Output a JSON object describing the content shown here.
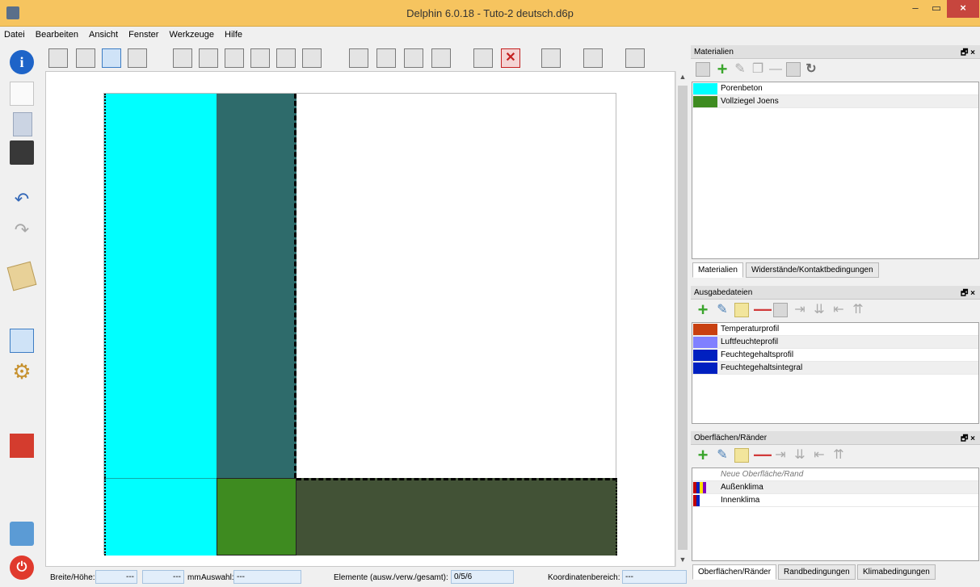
{
  "window": {
    "title": "Delphin 6.0.18 - Tuto-2 deutsch.d6p",
    "close_label": "×",
    "min_label": "–",
    "max_label": "▭"
  },
  "menu": [
    "Datei",
    "Bearbeiten",
    "Ansicht",
    "Fenster",
    "Werkzeuge",
    "Hilfe"
  ],
  "sidebar_icons": [
    "info-icon",
    "new-document-icon",
    "open-icon",
    "save-icon",
    "undo-icon",
    "redo-icon",
    "notes-icon",
    "geometry-icon",
    "settings-gears-icon",
    "flag-icon",
    "chat-icon",
    "power-icon"
  ],
  "canvas": {
    "cells": [
      {
        "name": "cyan-top",
        "color": "#00ffff"
      },
      {
        "name": "teal",
        "color": "#2e6b6b"
      },
      {
        "name": "cyan-bottom",
        "color": "#00ffff"
      },
      {
        "name": "green",
        "color": "#3e8b20"
      },
      {
        "name": "dark-green",
        "color": "#425236"
      }
    ]
  },
  "statusbar": {
    "breite_label": "Breite/Höhe:",
    "breite_value": "---",
    "hoehe_value": "---",
    "unit": "mm",
    "auswahl_label": "Auswahl:",
    "auswahl_value": "---",
    "elemente_label": "Elemente (ausw./verw./gesamt):",
    "elemente_value": "0/5/6",
    "koord_label": "Koordinatenbereich:",
    "koord_value": "---"
  },
  "materials": {
    "title": "Materialien",
    "items": [
      {
        "name": "Porenbeton",
        "color": "#00ffff"
      },
      {
        "name": "Vollziegel Joens",
        "color": "#3e8b20"
      }
    ],
    "tabs": [
      "Materialien",
      "Widerstände/Kontaktbedingungen"
    ]
  },
  "outputs": {
    "title": "Ausgabedateien",
    "items": [
      {
        "name": "Temperaturprofil",
        "color": "#c84010"
      },
      {
        "name": "Luftfeuchteprofil",
        "color": "#8080ff"
      },
      {
        "name": "Feuchtegehaltsprofil",
        "color": "#0020c0"
      },
      {
        "name": "Feuchtegehaltsintegral",
        "color": "#0020c0"
      }
    ]
  },
  "surfaces": {
    "title": "Oberflächen/Ränder",
    "placeholder": "Neue Oberfläche/Rand",
    "items": [
      {
        "name": "Außenklima",
        "colors": [
          "#c00000",
          "#0020c0",
          "#ffe000",
          "#8000c0"
        ]
      },
      {
        "name": "Innenklima",
        "colors": [
          "#c00000",
          "#0020c0"
        ]
      }
    ],
    "tabs": [
      "Oberflächen/Ränder",
      "Randbedingungen",
      "Klimabedingungen"
    ]
  },
  "dock_buttons": "🗗 ×"
}
